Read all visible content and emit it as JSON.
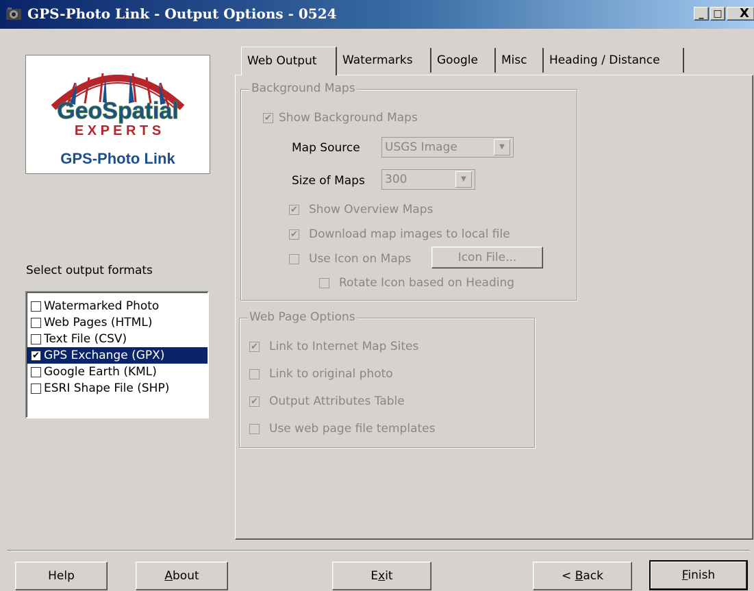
{
  "window": {
    "title": "GPS-Photo Link  - Output Options - 0524",
    "minimize": "_",
    "maximize": "□",
    "close": "X"
  },
  "logo": {
    "brand_line1": "GeoSpatial",
    "brand_line2": "E X P E R T S",
    "product": "GPS-Photo Link"
  },
  "formats": {
    "label": "Select output formats",
    "items": [
      {
        "label": "Watermarked Photo",
        "checked": false,
        "selected": false
      },
      {
        "label": "Web Pages (HTML)",
        "checked": false,
        "selected": false
      },
      {
        "label": "Text File (CSV)",
        "checked": false,
        "selected": false
      },
      {
        "label": "GPS Exchange (GPX)",
        "checked": true,
        "selected": true
      },
      {
        "label": "Google Earth (KML)",
        "checked": false,
        "selected": false
      },
      {
        "label": "ESRI Shape File (SHP)",
        "checked": false,
        "selected": false
      }
    ]
  },
  "tabs": [
    {
      "label": "Web Output",
      "active": true
    },
    {
      "label": "Watermarks",
      "active": false
    },
    {
      "label": "Google",
      "active": false
    },
    {
      "label": "Misc",
      "active": false
    },
    {
      "label": "Heading / Distance",
      "active": false
    }
  ],
  "background_maps": {
    "title": "Background Maps",
    "show_background_maps": {
      "label": "Show Background Maps",
      "checked": true
    },
    "map_source": {
      "label": "Map Source",
      "value": "USGS Image"
    },
    "size_of_maps": {
      "label": "Size of Maps",
      "value": "300"
    },
    "show_overview_maps": {
      "label": "Show Overview Maps",
      "checked": true
    },
    "download_map_images": {
      "label": "Download map images to local file",
      "checked": true
    },
    "use_icon_on_maps": {
      "label": "Use Icon on Maps",
      "checked": false
    },
    "icon_file_button": "Icon File...",
    "rotate_icon": {
      "label": "Rotate Icon based on Heading",
      "checked": false
    }
  },
  "web_page_options": {
    "title": "Web Page Options",
    "link_internet_map_sites": {
      "label": "Link to Internet Map Sites",
      "checked": true
    },
    "link_original_photo": {
      "label": "Link to original photo",
      "checked": false
    },
    "output_attributes_table": {
      "label": "Output Attributes Table",
      "checked": true
    },
    "use_web_page_templates": {
      "label": "Use web page file templates",
      "checked": false
    }
  },
  "buttons": {
    "help": "Help",
    "about_pre": "",
    "about_u": "A",
    "about_post": "bout",
    "exit_pre": "E",
    "exit_u": "x",
    "exit_post": "it",
    "back_pre": "< ",
    "back_u": "B",
    "back_post": "ack",
    "finish_pre": "",
    "finish_u": "F",
    "finish_post": "inish"
  },
  "colors": {
    "titlebar_start": "#0a246a",
    "titlebar_end": "#a6caf0",
    "face": "#d6d3ce",
    "selection": "#0a246a",
    "logo_red": "#b5252a",
    "logo_blue": "#1d4f8b",
    "logo_green": "#3f7d3a"
  }
}
